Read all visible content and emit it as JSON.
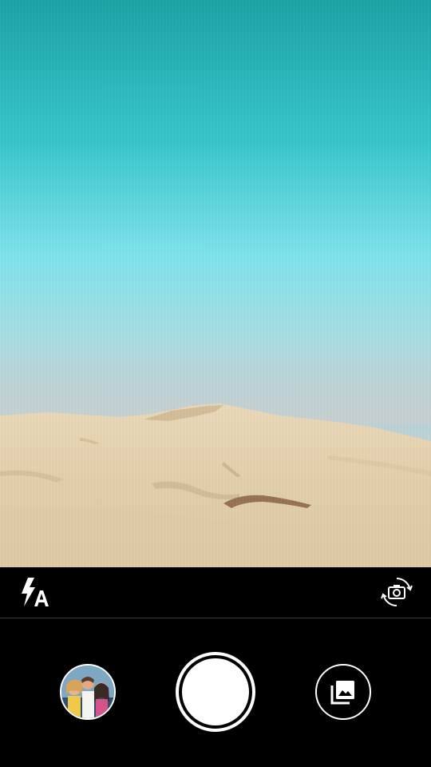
{
  "viewfinder": {
    "scene": "desert-dunes"
  },
  "controls": {
    "flash_mode_icon": "flash-auto-icon",
    "switch_camera_icon": "switch-camera-icon"
  },
  "bottom": {
    "thumbnail_icon": "last-photo-thumbnail",
    "shutter_icon": "shutter-icon",
    "gallery_icon": "gallery-icon"
  },
  "colors": {
    "background": "#000000",
    "icon": "#ffffff",
    "sky_top": "#1aa3a6",
    "sky_mid": "#7fe3ec",
    "sand": "#e4d3b2"
  }
}
